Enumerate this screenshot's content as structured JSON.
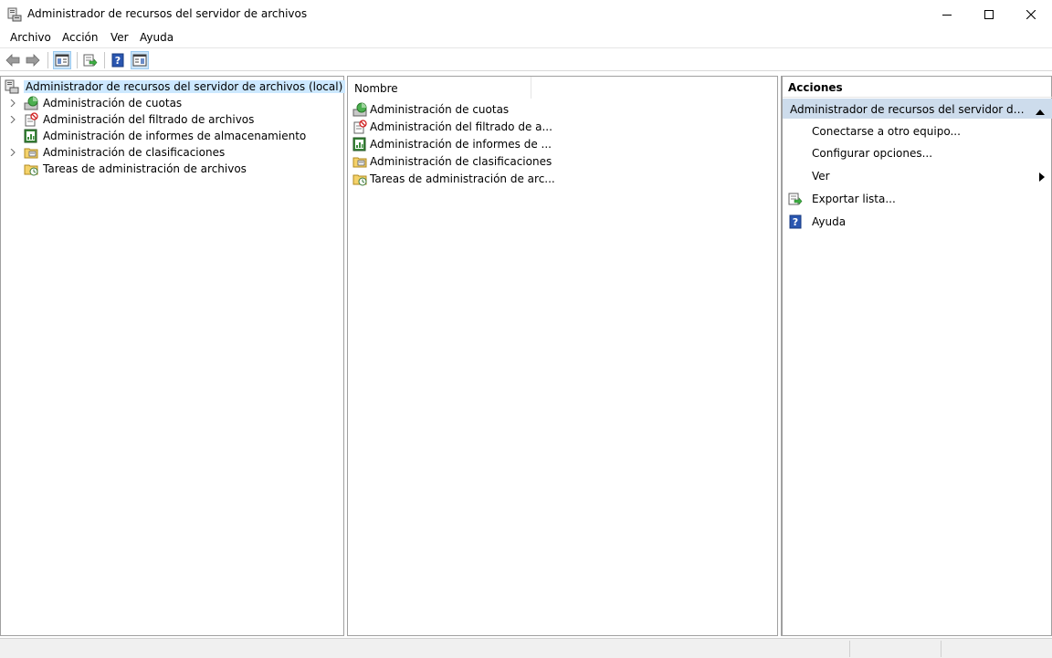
{
  "window": {
    "title": "Administrador de recursos del servidor de archivos",
    "app_icon": "file-server-icon",
    "controls": [
      "minimize-icon",
      "maximize-icon",
      "close-icon"
    ]
  },
  "menubar": {
    "items": [
      {
        "label": "Archivo"
      },
      {
        "label": "Acción"
      },
      {
        "label": "Ver"
      },
      {
        "label": "Ayuda"
      }
    ]
  },
  "toolbar": {
    "buttons": [
      "back-arrow-icon",
      "forward-arrow-icon",
      "show-hide-tree-icon",
      "export-list-icon",
      "help-icon",
      "show-hide-action-pane-icon"
    ]
  },
  "tree": {
    "root": {
      "label": "Administrador de recursos del servidor de archivos (local)",
      "icon": "file-server-icon",
      "selected": true
    },
    "items": [
      {
        "label": "Administración de cuotas",
        "icon": "quota-icon",
        "expandable": true
      },
      {
        "label": "Administración del filtrado de archivos",
        "icon": "file-screen-icon",
        "expandable": true
      },
      {
        "label": "Administración de informes de almacenamiento",
        "icon": "storage-report-icon",
        "expandable": false
      },
      {
        "label": "Administración de clasificaciones",
        "icon": "classification-icon",
        "expandable": true
      },
      {
        "label": "Tareas de administración de archivos",
        "icon": "file-task-icon",
        "expandable": false
      }
    ]
  },
  "list": {
    "column_header": "Nombre",
    "rows": [
      {
        "label": "Administración de cuotas",
        "icon": "quota-icon"
      },
      {
        "label": "Administración del filtrado de a...",
        "icon": "file-screen-icon"
      },
      {
        "label": "Administración de informes de ...",
        "icon": "storage-report-icon"
      },
      {
        "label": "Administración de clasificaciones",
        "icon": "classification-icon"
      },
      {
        "label": "Tareas de administración de arc...",
        "icon": "file-task-icon"
      }
    ]
  },
  "actions": {
    "title": "Acciones",
    "section_label": "Administrador de recursos del servidor de archi...",
    "items": [
      {
        "label": "Conectarse a otro equipo...",
        "icon": ""
      },
      {
        "label": "Configurar opciones...",
        "icon": ""
      },
      {
        "label": "Ver",
        "icon": "",
        "submenu": true
      },
      {
        "label": "Exportar lista...",
        "icon": "export-list-icon"
      },
      {
        "label": "Ayuda",
        "icon": "help-icon"
      }
    ]
  },
  "colors": {
    "selection": "#cce8ff",
    "actions_section_bg": "#cddcec",
    "pane_border": "#a0a0a0"
  }
}
